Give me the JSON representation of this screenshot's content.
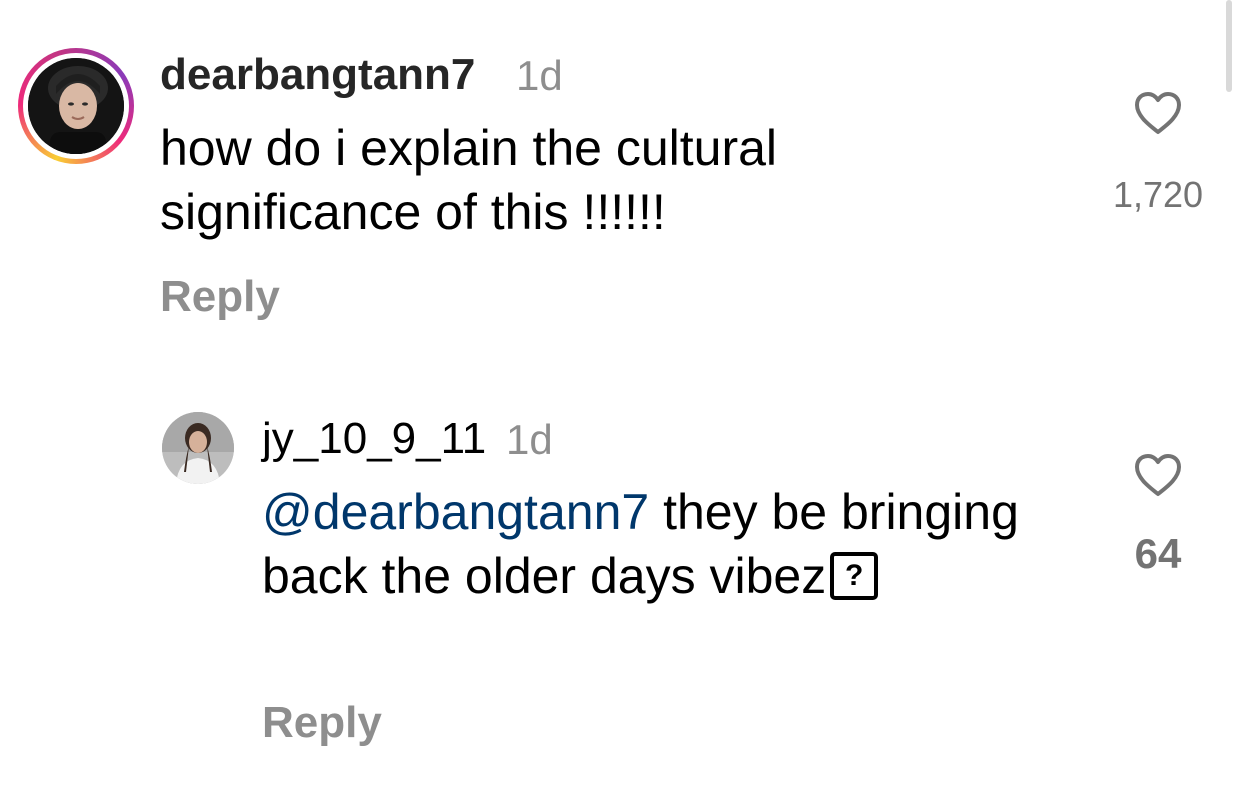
{
  "comments": [
    {
      "username": "dearbangtann7",
      "timestamp": "1d",
      "text": "how do i explain the cultural significance of this !!!!!!",
      "like_count": "1,720",
      "reply_label": "Reply",
      "avatar_icon": "profile-photo-icon",
      "story_ring": true
    },
    {
      "username": "jy_10_9_11",
      "timestamp": "1d",
      "mention": "@dearbangtann7",
      "text": " they be bringing back the older days vibez",
      "emoji_placeholder": "?",
      "like_count": "64",
      "reply_label": "Reply",
      "avatar_icon": "profile-photo-icon"
    }
  ],
  "icons": {
    "like": "heart-outline-icon"
  },
  "colors": {
    "username": "#262626",
    "secondary_text": "#8e8e8e",
    "mention": "#00376b",
    "like_icon": "#737373"
  }
}
